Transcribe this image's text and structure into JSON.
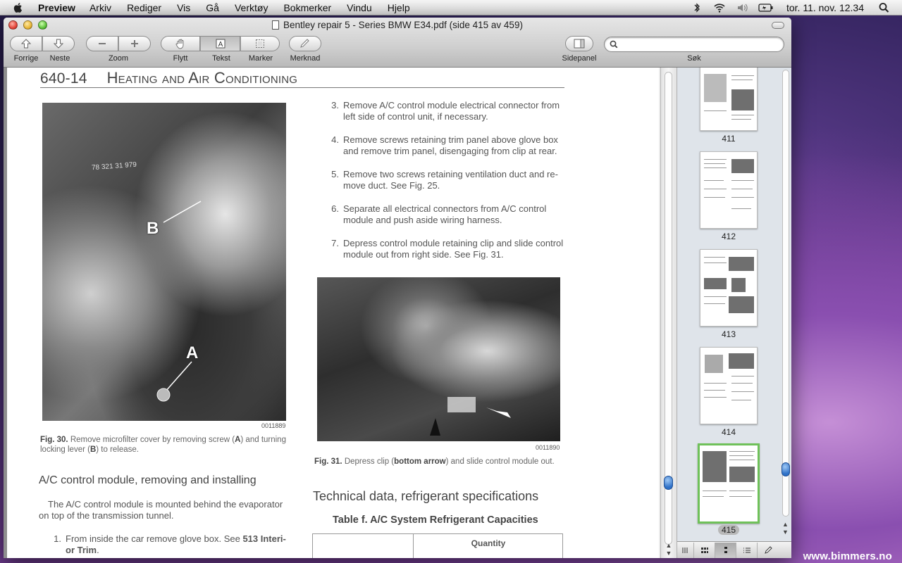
{
  "menubar": {
    "app": "Preview",
    "items": [
      "Arkiv",
      "Rediger",
      "Vis",
      "Gå",
      "Verktøy",
      "Bokmerker",
      "Vindu",
      "Hjelp"
    ],
    "clock": "tor. 11. nov.  12.34"
  },
  "window": {
    "title": "Bentley repair 5 - Series BMW E34.pdf (side 415 av 459)"
  },
  "toolbar": {
    "prev_label": "Forrige",
    "next_label": "Neste",
    "zoom_label": "Zoom",
    "move_label": "Flytt",
    "text_label": "Tekst",
    "select_label": "Marker",
    "annotate_label": "Merknad",
    "sidebar_label": "Sidepanel",
    "search_label": "Søk",
    "search_value": "",
    "search_placeholder": ""
  },
  "page": {
    "number": "640-14",
    "title": "Heating and Air Conditioning",
    "photo1": {
      "label_a": "A",
      "label_b": "B",
      "id": "0011889",
      "stamp": "78 321 31 979"
    },
    "fig30": {
      "label": "Fig. 30.",
      "text_1": "Remove microfilter cover by removing screw (",
      "a": "A",
      "text_2": ") and turning locking lever (",
      "b": "B",
      "text_3": ") to release."
    },
    "steps": [
      {
        "n": "3.",
        "text": "Remove A/C control module electrical connector from left side of control unit, if necessary."
      },
      {
        "n": "4.",
        "text": "Remove screws retaining trim panel above glove box and remove trim panel, disengaging from clip at rear."
      },
      {
        "n": "5.",
        "text": "Remove two screws retaining ventilation duct and re-move duct. See Fig. 25."
      },
      {
        "n": "6.",
        "text": "Separate all electrical connectors from A/C control module and push aside wiring harness."
      },
      {
        "n": "7.",
        "text": "Depress control module retaining clip and slide control module out from right side. See Fig. 31."
      }
    ],
    "photo2": {
      "id": "0011890"
    },
    "fig31": {
      "label": "Fig. 31.",
      "text_1": "Depress clip (",
      "b": "bottom arrow",
      "text_2": ") and slide control module out."
    },
    "section1_heading": "A/C control module, removing and installing",
    "section1_body": "The A/C control module is mounted behind the evaporator on top of the transmission tunnel.",
    "section1_step": {
      "n": "1.",
      "text": "From inside the car remove glove box. See ",
      "b": "513 Interi-or Trim",
      "end": "."
    },
    "section2_heading": "Technical data, refrigerant specifications",
    "table_title": "Table f. A/C System Refrigerant Capacities",
    "table_col": "Quantity"
  },
  "sidebar": {
    "thumbs": [
      {
        "label": "411"
      },
      {
        "label": "412"
      },
      {
        "label": "413"
      },
      {
        "label": "414"
      },
      {
        "label": "415"
      }
    ]
  },
  "watermark": "www.bimmers.no"
}
